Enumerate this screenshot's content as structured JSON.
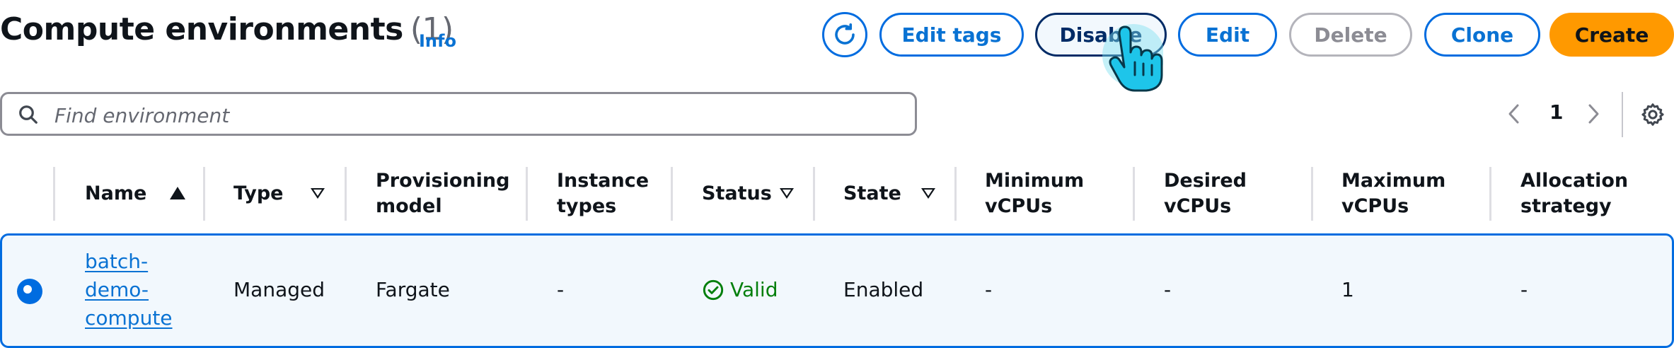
{
  "header": {
    "title": "Compute environments",
    "count": "(1)",
    "info_label": "Info"
  },
  "toolbar": {
    "refresh_icon": "refresh-icon",
    "edit_tags_label": "Edit tags",
    "disable_label": "Disable",
    "edit_label": "Edit",
    "delete_label": "Delete",
    "clone_label": "Clone",
    "create_label": "Create"
  },
  "search": {
    "placeholder": "Find environment",
    "value": ""
  },
  "pagination": {
    "current_page": "1"
  },
  "table": {
    "columns": {
      "name": "Name",
      "type": "Type",
      "provisioning_model": "Provisioning model",
      "instance_types": "Instance types",
      "status": "Status",
      "state": "State",
      "min_vcpus": "Minimum vCPUs",
      "desired_vcpus": "Desired vCPUs",
      "max_vcpus": "Maximum vCPUs",
      "allocation_strategy": "Allocation strategy"
    },
    "rows": [
      {
        "selected": true,
        "name": "batch-demo-compute",
        "type": "Managed",
        "provisioning_model": "Fargate",
        "instance_types": "-",
        "status": "Valid",
        "state": "Enabled",
        "min_vcpus": "-",
        "desired_vcpus": "-",
        "max_vcpus": "1",
        "allocation_strategy": "-"
      }
    ]
  },
  "colors": {
    "link": "#0972d3",
    "primary": "#ff9900",
    "selected_row_bg": "#f2f8fd",
    "selected_border": "#006ce0",
    "success": "#037f0c"
  }
}
